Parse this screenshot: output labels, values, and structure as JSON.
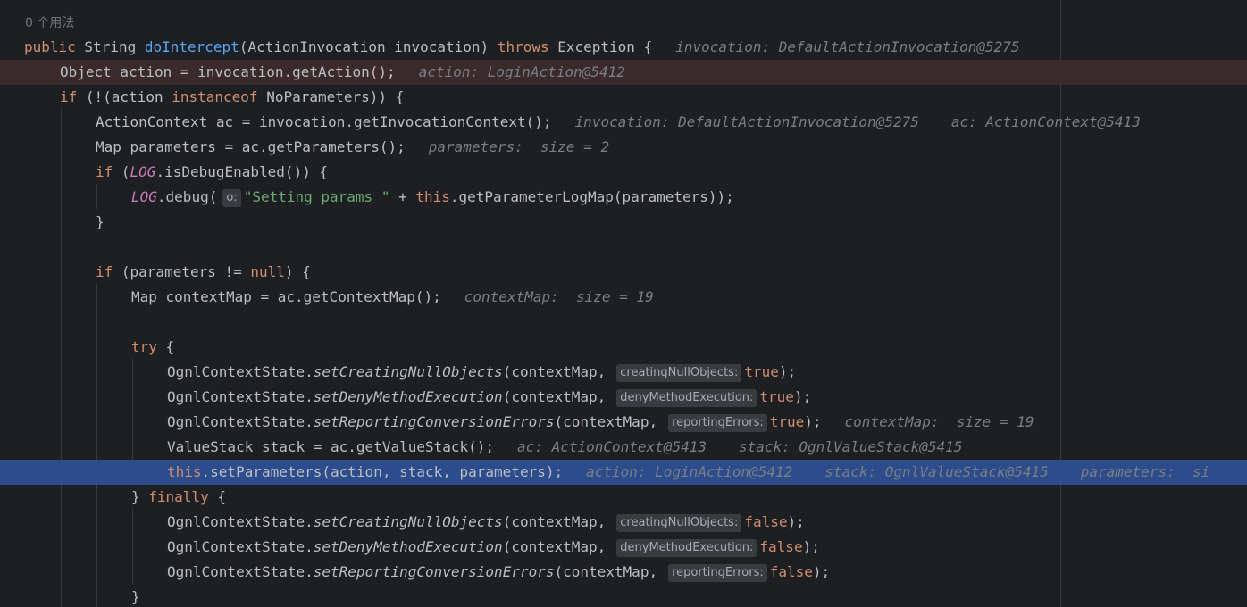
{
  "editor": {
    "usage_hint": "0 个用法",
    "colors": {
      "background": "#1e1f22",
      "breakpoint_line": "#3b2a2c",
      "execution_line": "#2d4c8c",
      "keyword": "#cf8e6d",
      "method_declaration": "#56a8f5",
      "static_field": "#c77dbb",
      "string": "#6aab73",
      "inline_debug_value": "#7a7e85",
      "default_text": "#bcbec4"
    },
    "lines": {
      "l01": {
        "kw1": "public",
        "t1": " String ",
        "fn": "doIntercept",
        "t2": "(ActionInvocation invocation) ",
        "kw2": "throws",
        "t3": " Exception {",
        "v1": "invocation: DefaultActionInvocation@5275"
      },
      "l02": {
        "t1": "Object action = invocation.getAction();",
        "v1": "action: LoginAction@5412"
      },
      "l03": {
        "kw1": "if",
        "t1": " (!(action ",
        "kw2": "instanceof",
        "t2": " NoParameters)) {"
      },
      "l04": {
        "t1": "ActionContext ac = invocation.getInvocationContext();",
        "v1": "invocation: DefaultActionInvocation@5275",
        "v2": "ac: ActionContext@5413"
      },
      "l05": {
        "t1": "Map parameters = ac.getParameters();",
        "v1": "parameters:  size = 2"
      },
      "l06": {
        "kw1": "if",
        "t1": " (",
        "st1": "LOG",
        "t2": ".isDebugEnabled()) {"
      },
      "l07": {
        "st1": "LOG",
        "t1": ".debug(",
        "hint": "o:",
        "str": "\"Setting params \"",
        "t2": " + ",
        "kw1": "this",
        "t3": ".getParameterLogMap(parameters));"
      },
      "l08": {
        "t1": "}"
      },
      "l10": {
        "kw1": "if",
        "t1": " (parameters != ",
        "kw2": "null",
        "t2": ") {"
      },
      "l11": {
        "t1": "Map contextMap = ac.getContextMap();",
        "v1": "contextMap:  size = 19"
      },
      "l13": {
        "kw1": "try",
        "t1": " {"
      },
      "l14": {
        "t1": "OgnlContextState.",
        "sm": "setCreatingNullObjects",
        "t2": "(contextMap,",
        "hint": "creatingNullObjects:",
        "kw1": "true",
        "t3": ");"
      },
      "l15": {
        "t1": "OgnlContextState.",
        "sm": "setDenyMethodExecution",
        "t2": "(contextMap,",
        "hint": "denyMethodExecution:",
        "kw1": "true",
        "t3": ");"
      },
      "l16": {
        "t1": "OgnlContextState.",
        "sm": "setReportingConversionErrors",
        "t2": "(contextMap,",
        "hint": "reportingErrors:",
        "kw1": "true",
        "t3": ");",
        "v1": "contextMap:  size = 19"
      },
      "l17": {
        "t1": "ValueStack stack = ac.getValueStack();",
        "v1": "ac: ActionContext@5413",
        "v2": "stack: OgnlValueStack@5415"
      },
      "l18": {
        "kw1": "this",
        "t1": ".setParameters(action, stack, parameters);",
        "v1": "action: LoginAction@5412",
        "v2": "stack: OgnlValueStack@5415",
        "v3": "parameters:  si"
      },
      "l19": {
        "t1": "} ",
        "kw1": "finally",
        "t2": " {"
      },
      "l20": {
        "t1": "OgnlContextState.",
        "sm": "setCreatingNullObjects",
        "t2": "(contextMap,",
        "hint": "creatingNullObjects:",
        "kw1": "false",
        "t3": ");"
      },
      "l21": {
        "t1": "OgnlContextState.",
        "sm": "setDenyMethodExecution",
        "t2": "(contextMap,",
        "hint": "denyMethodExecution:",
        "kw1": "false",
        "t3": ");"
      },
      "l22": {
        "t1": "OgnlContextState.",
        "sm": "setReportingConversionErrors",
        "t2": "(contextMap,",
        "hint": "reportingErrors:",
        "kw1": "false",
        "t3": ");"
      },
      "l23": {
        "t1": "}"
      }
    }
  }
}
